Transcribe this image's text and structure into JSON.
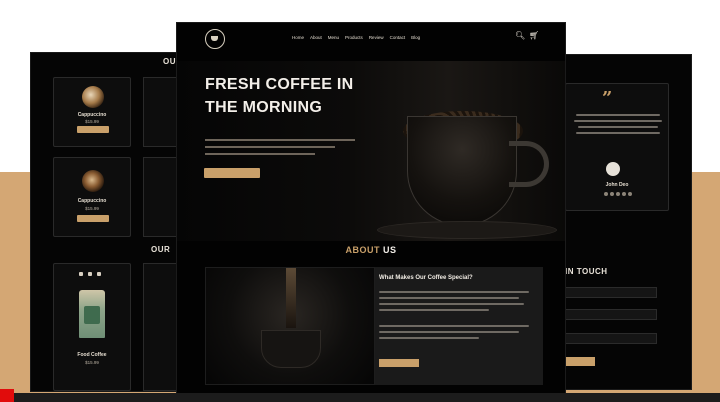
{
  "colors": {
    "accent": "#c9a06a",
    "background": "#020202",
    "band": "#d4a774"
  },
  "front": {
    "nav": [
      "Home",
      "About",
      "Menu",
      "Products",
      "Review",
      "Contact",
      "Blog"
    ],
    "hero_title_1": "FRESH COFFEE IN",
    "hero_title_2": "THE MORNING",
    "about_title_a": "ABOUT",
    "about_title_b": " US",
    "about_heading": "What Makes Our Coffee Special?",
    "icons": {
      "search": "search-icon",
      "cart": "cart-icon"
    }
  },
  "left": {
    "section_1": "OU",
    "section_2": "OUR",
    "cards": [
      {
        "name": "Cappuccino",
        "price": "$15.99"
      },
      {
        "name": "Cappuccino",
        "price": "$15.99"
      }
    ],
    "product": {
      "name": "Food Coffee",
      "price": "$15.99"
    }
  },
  "right": {
    "section": "IN TOUCH",
    "quote": "”",
    "reviewer": "John Deo"
  }
}
